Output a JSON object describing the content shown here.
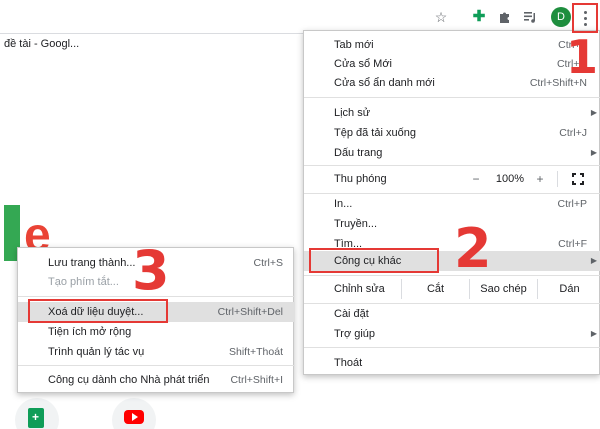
{
  "browser": {
    "tab_title": "đề tài - Googl...",
    "avatar_letter": "D",
    "icons": [
      "star-icon",
      "extension-add-icon",
      "puzzle-icon",
      "playlist-icon",
      "kebab-menu-icon"
    ]
  },
  "main_menu": {
    "new_tab": {
      "label": "Tab mới",
      "shortcut": "Ctrl+T"
    },
    "new_window": {
      "label": "Cửa sổ Mới",
      "shortcut": "Ctrl+N"
    },
    "incognito": {
      "label": "Cửa sổ ẩn danh mới",
      "shortcut": "Ctrl+Shift+N"
    },
    "history": {
      "label": "Lịch sử"
    },
    "downloads": {
      "label": "Tệp đã tải xuống",
      "shortcut": "Ctrl+J"
    },
    "bookmarks": {
      "label": "Dấu trang"
    },
    "zoom": {
      "label": "Thu phóng",
      "minus": "−",
      "value": "100%",
      "plus": "+"
    },
    "print": {
      "label": "In...",
      "shortcut": "Ctrl+P"
    },
    "cast": {
      "label": "Truyền..."
    },
    "find": {
      "label": "Tìm...",
      "shortcut": "Ctrl+F"
    },
    "more_tools": {
      "label": "Công cụ khác"
    },
    "edit": {
      "label": "Chỉnh sửa",
      "cut": "Cắt",
      "copy": "Sao chép",
      "paste": "Dán"
    },
    "settings": {
      "label": "Cài đặt"
    },
    "help": {
      "label": "Trợ giúp"
    },
    "exit": {
      "label": "Thoát"
    }
  },
  "sub_menu": {
    "save_page": {
      "label": "Lưu trang thành...",
      "shortcut": "Ctrl+S"
    },
    "create_shortcut": {
      "label": "Tạo phím tắt..."
    },
    "clear_data": {
      "label": "Xoá dữ liệu duyệt...",
      "shortcut": "Ctrl+Shift+Del"
    },
    "extensions": {
      "label": "Tiện ích mở rộng"
    },
    "task_manager": {
      "label": "Trình quản lý tác vụ",
      "shortcut": "Shift+Thoát"
    },
    "dev_tools": {
      "label": "Công cụ dành cho Nhà phát triển",
      "shortcut": "Ctrl+Shift+I"
    }
  },
  "annotations": {
    "step1": "1",
    "step2": "2",
    "step3": "3"
  },
  "colors": {
    "annotation": "#e53935",
    "highlight": "#e0e0e0",
    "avatar": "#1e8e3e"
  }
}
